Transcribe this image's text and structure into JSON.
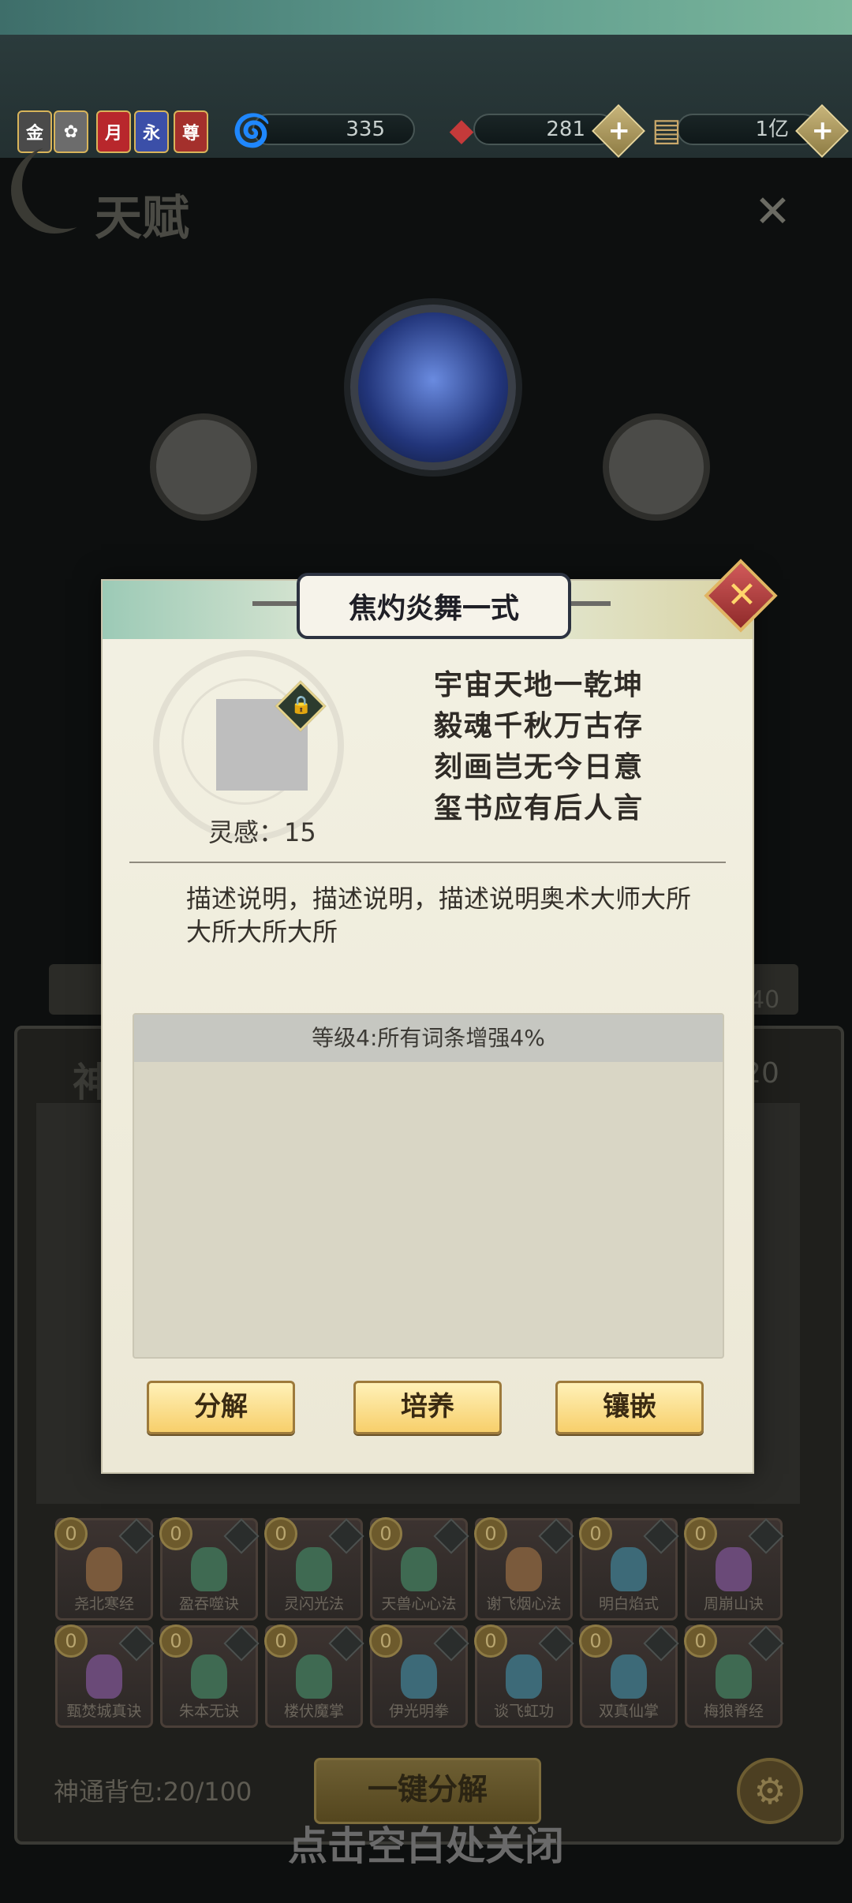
{
  "resources": {
    "badges": [
      "金",
      "",
      "月",
      "永",
      "尊"
    ],
    "spirit_value": "335",
    "gem_value": "281",
    "coin_value": "1亿"
  },
  "background": {
    "talent_title": "天赋",
    "panel_title": "神",
    "panel_count": "/20",
    "strip_value": "40",
    "bag_label": "神通背包:20/100",
    "one_key_label": "一键分解",
    "close_hint": "点击空白处关闭",
    "items": [
      {
        "count": "0",
        "name": "尧北寒经",
        "color": "#7a5a3c"
      },
      {
        "count": "0",
        "name": "盈吞噬诀",
        "color": "#3f6a52"
      },
      {
        "count": "0",
        "name": "灵闪光法",
        "color": "#3f6a52"
      },
      {
        "count": "0",
        "name": "天兽心心法",
        "color": "#3f6a52"
      },
      {
        "count": "0",
        "name": "谢飞烟心法",
        "color": "#7a5a3c"
      },
      {
        "count": "0",
        "name": "明白焰式",
        "color": "#3d6a78"
      },
      {
        "count": "0",
        "name": "周崩山诀",
        "color": "#6a4a78"
      },
      {
        "count": "0",
        "name": "甄焚城真诀",
        "color": "#6a4a78"
      },
      {
        "count": "0",
        "name": "朱本无诀",
        "color": "#3f6a52"
      },
      {
        "count": "0",
        "name": "楼伏魔掌",
        "color": "#3f6a52"
      },
      {
        "count": "0",
        "name": "伊光明拳",
        "color": "#3d6a78"
      },
      {
        "count": "0",
        "name": "谈飞虹功",
        "color": "#3d6a78"
      },
      {
        "count": "0",
        "name": "双真仙掌",
        "color": "#3d6a78"
      },
      {
        "count": "0",
        "name": "梅狼脊经",
        "color": "#3f6a52"
      }
    ]
  },
  "modal": {
    "title": "焦灼炎舞一式",
    "inspiration": "灵感：15",
    "poem": [
      "宇宙天地一乾坤",
      "毅魂千秋万古存",
      "刻画岂无今日意",
      "玺书应有后人言"
    ],
    "description": "描述说明，描述说明，描述说明奥术大师大所大所大所大所",
    "effect_header": "等级4:所有词条增强4%",
    "buttons": {
      "decompose": "分解",
      "cultivate": "培养",
      "inlay": "镶嵌"
    }
  }
}
